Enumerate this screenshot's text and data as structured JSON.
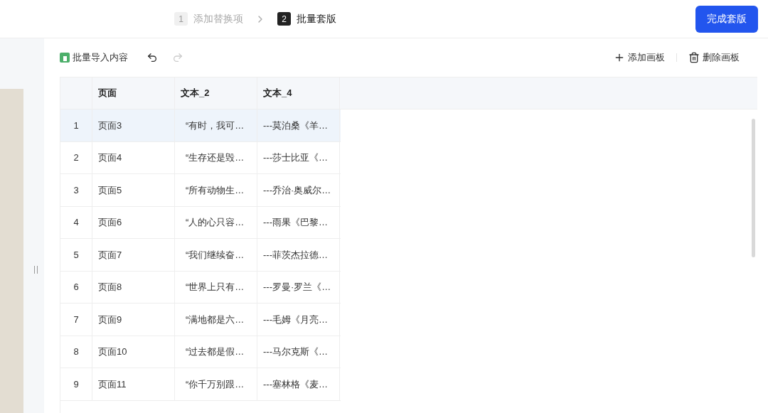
{
  "steps": [
    {
      "number": "1",
      "label": "添加替换项",
      "selected": false
    },
    {
      "number": "2",
      "label": "批量套版",
      "selected": true
    }
  ],
  "finish_button": "完成套版",
  "toolbar": {
    "import_button": "批量导入内容",
    "undo_disabled": false,
    "redo_disabled": true,
    "add_board": "添加画板",
    "delete_board": "删除画板"
  },
  "table": {
    "columns": [
      "页面",
      "文本_2",
      "文本_4"
    ],
    "rows": [
      {
        "index": "1",
        "cells": [
          "页面3",
          "“有时，我可…",
          "---莫泊桑《羊…"
        ],
        "selected": true
      },
      {
        "index": "2",
        "cells": [
          "页面4",
          "“生存还是毁…",
          "---莎士比亚《…"
        ],
        "selected": false
      },
      {
        "index": "3",
        "cells": [
          "页面5",
          "“所有动物生…",
          "---乔治·奥威尔…"
        ],
        "selected": false
      },
      {
        "index": "4",
        "cells": [
          "页面6",
          "“人的心只容…",
          "---雨果《巴黎…"
        ],
        "selected": false
      },
      {
        "index": "5",
        "cells": [
          "页面7",
          "“我们继续奋…",
          "---菲茨杰拉德…"
        ],
        "selected": false
      },
      {
        "index": "6",
        "cells": [
          "页面8",
          "“世界上只有…",
          "---罗曼·罗兰《…"
        ],
        "selected": false
      },
      {
        "index": "7",
        "cells": [
          "页面9",
          "“满地都是六…",
          "---毛姆《月亮…"
        ],
        "selected": false
      },
      {
        "index": "8",
        "cells": [
          "页面10",
          "“过去都是假…",
          "---马尔克斯《…"
        ],
        "selected": false
      },
      {
        "index": "9",
        "cells": [
          "页面11",
          "“你千万别跟…",
          "---塞林格《麦…"
        ],
        "selected": false
      }
    ]
  }
}
